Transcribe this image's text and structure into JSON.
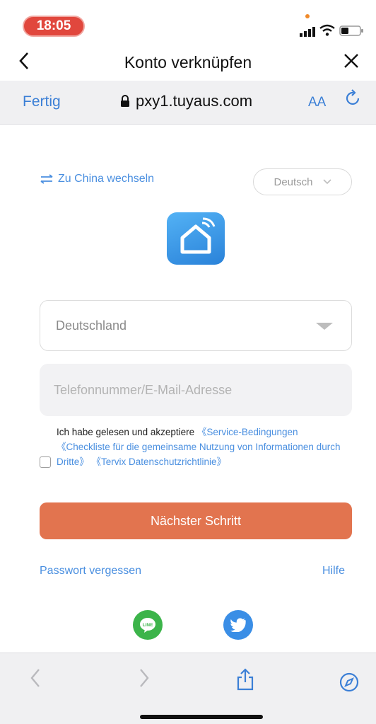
{
  "status_bar": {
    "time": "18:05"
  },
  "nav": {
    "back_icon": "chevron-left-icon",
    "title": "Konto verknüpfen",
    "close_icon": "close-icon"
  },
  "browser": {
    "done_label": "Fertig",
    "url": "pxy1.tuyaus.com",
    "text_size_label": "AA"
  },
  "page": {
    "switch_region_label": "Zu China wechseln",
    "language": "Deutsch",
    "country": "Deutschland",
    "phone_placeholder": "Telefonnummer/E-Mail-Adresse",
    "terms": {
      "prefix": "Ich habe gelesen und akzeptiere ",
      "link1": "《Service-Bedingungen 《Checkliste für die gemeinsame Nutzung von Informationen durch Dritte》 《Tervix Datenschutzrichtlinie》"
    },
    "next_button": "Nächster Schritt",
    "forgot_password": "Passwort vergessen",
    "help": "Hilfe",
    "line_label": "LINE"
  },
  "colors": {
    "accent": "#e2744f",
    "link": "#4a8fe0",
    "time_pill": "#e1473d"
  }
}
